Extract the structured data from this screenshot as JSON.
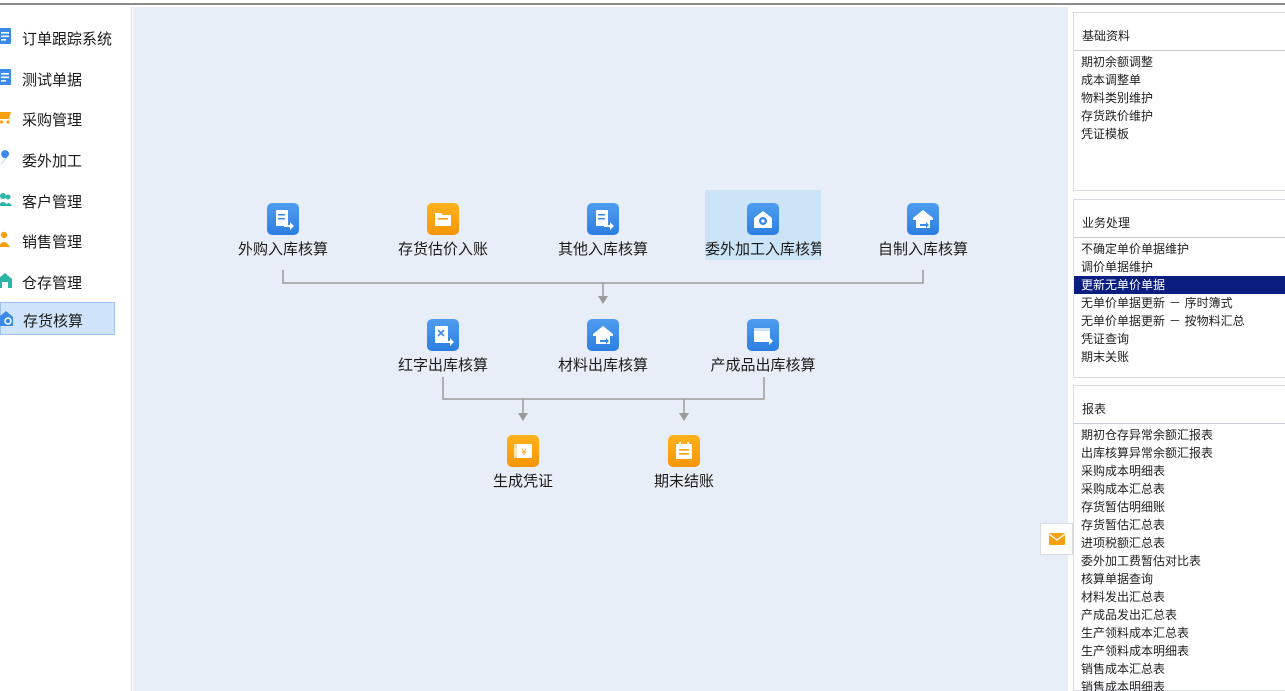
{
  "sidebar": {
    "items": [
      {
        "label": "订单跟踪系统",
        "icon": "document-list-icon"
      },
      {
        "label": "测试单据",
        "icon": "document-list-icon"
      },
      {
        "label": "采购管理",
        "icon": "shopping-cart-icon"
      },
      {
        "label": "委外加工",
        "icon": "wrench-icon"
      },
      {
        "label": "客户管理",
        "icon": "users-icon"
      },
      {
        "label": "销售管理",
        "icon": "salesperson-icon"
      },
      {
        "label": "仓存管理",
        "icon": "warehouse-icon"
      },
      {
        "label": "存货核算",
        "icon": "inventory-calc-icon"
      }
    ],
    "active_index": 7
  },
  "flow": {
    "row1": [
      {
        "label": "外购入库核算",
        "icon": "inbound-doc-icon",
        "color": "#3b8ae8"
      },
      {
        "label": "存货估价入账",
        "icon": "folder-icon",
        "color": "#f7a010"
      },
      {
        "label": "其他入库核算",
        "icon": "inbound-doc-icon",
        "color": "#3b8ae8"
      },
      {
        "label": "委外加工入库核算",
        "icon": "gear-house-icon",
        "color": "#3b8ae8"
      },
      {
        "label": "自制入库核算",
        "icon": "house-arrow-icon",
        "color": "#3b8ae8"
      }
    ],
    "row2": [
      {
        "label": "红字出库核算",
        "icon": "red-outbound-icon",
        "color": "#3b8ae8"
      },
      {
        "label": "材料出库核算",
        "icon": "house-arrow-icon",
        "color": "#3b8ae8"
      },
      {
        "label": "产成品出库核算",
        "icon": "product-out-icon",
        "color": "#3b8ae8"
      }
    ],
    "row3": [
      {
        "label": "生成凭证",
        "icon": "yuan-voucher-icon",
        "color": "#f7a010"
      },
      {
        "label": "期末结账",
        "icon": "calendar-list-icon",
        "color": "#f7a010"
      }
    ]
  },
  "panels": {
    "basic": {
      "title": "基础资料",
      "items": [
        "期初余额调整",
        "成本调整单",
        "物料类别维护",
        "存货跌价维护",
        "凭证模板"
      ]
    },
    "business": {
      "title": "业务处理",
      "items": [
        "不确定单价单据维护",
        "调价单据维护",
        "更新无单价单据",
        "无单价单据更新 － 序时簿式",
        "无单价单据更新 － 按物料汇总",
        "凭证查询",
        "期末关账"
      ],
      "highlight_index": 2
    },
    "reports": {
      "title": "报表",
      "items": [
        "期初仓存异常余额汇报表",
        "出库核算异常余额汇报表",
        "采购成本明细表",
        "采购成本汇总表",
        "存货暂估明细账",
        "存货暂估汇总表",
        "进项税额汇总表",
        "委外加工费暂估对比表",
        "核算单据查询",
        "材料发出汇总表",
        "产成品发出汇总表",
        "生产领料成本汇总表",
        "生产领料成本明细表",
        "销售成本汇总表",
        "销售成本明细表"
      ]
    }
  },
  "colors": {
    "canvas_bg": "#e8eef7",
    "icon_blue": "#3b8ae8",
    "icon_orange": "#f7a010",
    "highlight_bg": "#0a1e80",
    "selected_node_bg": "#cce4f7"
  }
}
